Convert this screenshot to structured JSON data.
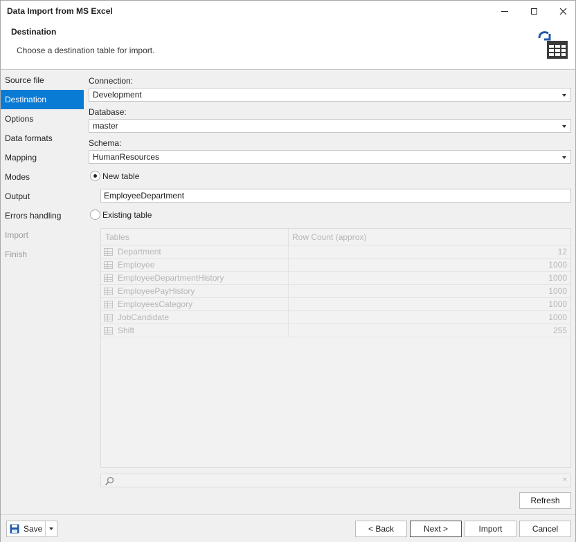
{
  "window": {
    "title": "Data Import from MS Excel"
  },
  "header": {
    "title": "Destination",
    "subtitle": "Choose a destination table for import.",
    "icon": "table-import-icon"
  },
  "sidebar": {
    "items": [
      {
        "label": "Source file",
        "state": "normal"
      },
      {
        "label": "Destination",
        "state": "active"
      },
      {
        "label": "Options",
        "state": "normal"
      },
      {
        "label": "Data formats",
        "state": "normal"
      },
      {
        "label": "Mapping",
        "state": "normal"
      },
      {
        "label": "Modes",
        "state": "normal"
      },
      {
        "label": "Output",
        "state": "normal"
      },
      {
        "label": "Errors handling",
        "state": "normal"
      },
      {
        "label": "Import",
        "state": "disabled"
      },
      {
        "label": "Finish",
        "state": "disabled"
      }
    ]
  },
  "form": {
    "connection_label": "Connection:",
    "connection_value": "Development",
    "database_label": "Database:",
    "database_value": "master",
    "schema_label": "Schema:",
    "schema_value": "HumanResources",
    "new_table_label": "New table",
    "new_table_selected": true,
    "new_table_value": "EmployeeDepartment",
    "existing_table_label": "Existing table"
  },
  "tables": {
    "columns": [
      "Tables",
      "Row Count (approx)"
    ],
    "rows": [
      {
        "name": "Department",
        "count": "12"
      },
      {
        "name": "Employee",
        "count": "1000"
      },
      {
        "name": "EmployeeDepartmentHistory",
        "count": "1000"
      },
      {
        "name": "EmployeePayHistory",
        "count": "1000"
      },
      {
        "name": "EmployeesCategory",
        "count": "1000"
      },
      {
        "name": "JobCandidate",
        "count": "1000"
      },
      {
        "name": "Shift",
        "count": "255"
      }
    ]
  },
  "search": {
    "clear": "×"
  },
  "buttons": {
    "refresh": "Refresh",
    "save": "Save",
    "back": "< Back",
    "next": "Next >",
    "import": "Import",
    "cancel": "Cancel"
  },
  "colors": {
    "accent": "#0a7bd5",
    "brand_icon": "#1e5aa8"
  }
}
